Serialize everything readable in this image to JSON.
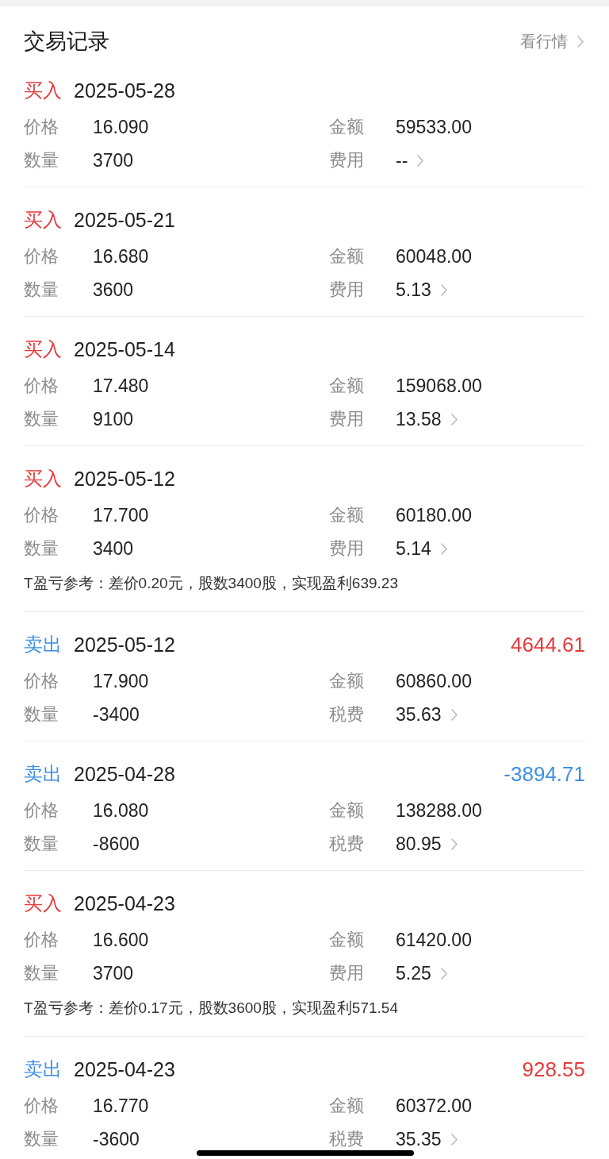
{
  "header": {
    "title": "交易记录",
    "link": "看行情"
  },
  "records": [
    {
      "kind": "buy",
      "type": "买入",
      "date": "2025-05-28",
      "fields": [
        {
          "kind": "plain",
          "label": "价格",
          "value": "16.090"
        },
        {
          "kind": "plain",
          "label": "金额",
          "value": "59533.00"
        },
        {
          "kind": "plain",
          "label": "数量",
          "value": "3700"
        },
        {
          "kind": "link",
          "label": "费用",
          "value": "--"
        }
      ]
    },
    {
      "kind": "buy",
      "type": "买入",
      "date": "2025-05-21",
      "fields": [
        {
          "kind": "plain",
          "label": "价格",
          "value": "16.680"
        },
        {
          "kind": "plain",
          "label": "金额",
          "value": "60048.00"
        },
        {
          "kind": "plain",
          "label": "数量",
          "value": "3600"
        },
        {
          "kind": "link",
          "label": "费用",
          "value": "5.13"
        }
      ]
    },
    {
      "kind": "buy",
      "type": "买入",
      "date": "2025-05-14",
      "fields": [
        {
          "kind": "plain",
          "label": "价格",
          "value": "17.480"
        },
        {
          "kind": "plain",
          "label": "金额",
          "value": "159068.00"
        },
        {
          "kind": "plain",
          "label": "数量",
          "value": "9100"
        },
        {
          "kind": "link",
          "label": "费用",
          "value": "13.58"
        }
      ]
    },
    {
      "kind": "buy",
      "type": "买入",
      "date": "2025-05-12",
      "fields": [
        {
          "kind": "plain",
          "label": "价格",
          "value": "17.700"
        },
        {
          "kind": "plain",
          "label": "金额",
          "value": "60180.00"
        },
        {
          "kind": "plain",
          "label": "数量",
          "value": "3400"
        },
        {
          "kind": "link",
          "label": "费用",
          "value": "5.14"
        }
      ],
      "note": "T盈亏参考：差价0.20元，股数3400股，实现盈利639.23"
    },
    {
      "kind": "sell",
      "type": "卖出",
      "date": "2025-05-12",
      "result": {
        "kind": "gain",
        "text": "4644.61"
      },
      "fields": [
        {
          "kind": "plain",
          "label": "价格",
          "value": "17.900"
        },
        {
          "kind": "plain",
          "label": "金额",
          "value": "60860.00"
        },
        {
          "kind": "plain",
          "label": "数量",
          "value": "-3400"
        },
        {
          "kind": "link",
          "label": "税费",
          "value": "35.63"
        }
      ]
    },
    {
      "kind": "sell",
      "type": "卖出",
      "date": "2025-04-28",
      "result": {
        "kind": "loss",
        "text": "-3894.71"
      },
      "fields": [
        {
          "kind": "plain",
          "label": "价格",
          "value": "16.080"
        },
        {
          "kind": "plain",
          "label": "金额",
          "value": "138288.00"
        },
        {
          "kind": "plain",
          "label": "数量",
          "value": "-8600"
        },
        {
          "kind": "link",
          "label": "税费",
          "value": "80.95"
        }
      ]
    },
    {
      "kind": "buy",
      "type": "买入",
      "date": "2025-04-23",
      "fields": [
        {
          "kind": "plain",
          "label": "价格",
          "value": "16.600"
        },
        {
          "kind": "plain",
          "label": "金额",
          "value": "61420.00"
        },
        {
          "kind": "plain",
          "label": "数量",
          "value": "3700"
        },
        {
          "kind": "link",
          "label": "费用",
          "value": "5.25"
        }
      ],
      "note": "T盈亏参考：差价0.17元，股数3600股，实现盈利571.54"
    },
    {
      "kind": "sell",
      "type": "卖出",
      "date": "2025-04-23",
      "result": {
        "kind": "gain",
        "text": "928.55"
      },
      "fields": [
        {
          "kind": "plain",
          "label": "价格",
          "value": "16.770"
        },
        {
          "kind": "plain",
          "label": "金额",
          "value": "60372.00"
        },
        {
          "kind": "plain",
          "label": "数量",
          "value": "-3600"
        },
        {
          "kind": "link",
          "label": "税费",
          "value": "35.35"
        }
      ]
    }
  ]
}
